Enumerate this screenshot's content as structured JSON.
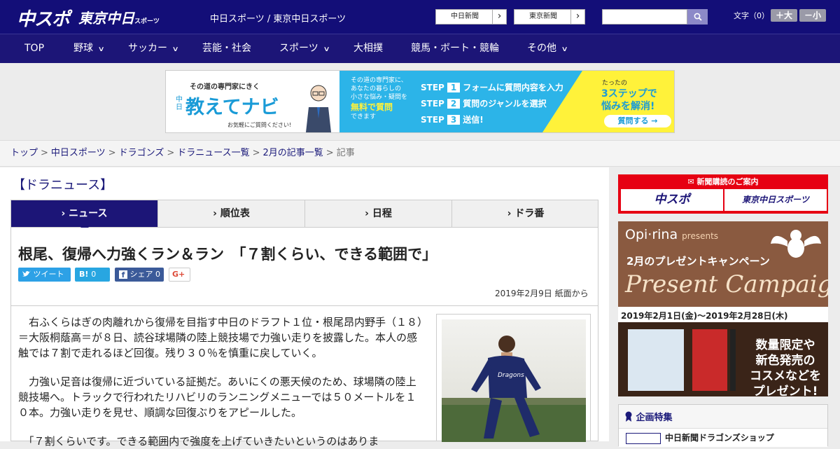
{
  "header": {
    "logo_main": "中スポ",
    "logo_tokyo": "東京中日",
    "logo_tokyo_small": "スポーツ",
    "site_title": "中日スポーツ / 東京中日スポーツ",
    "links": [
      "中日新聞",
      "東京新聞"
    ],
    "link_arrow": "›",
    "font_size_label": "文字（0）",
    "font_plus": "＋大",
    "font_minus": "－小",
    "bg_color": "#130e78"
  },
  "nav": {
    "items": [
      "TOP",
      "野球",
      "サッカー",
      "芸能・社会",
      "スポーツ",
      "大相撲",
      "競馬・ボート・競輪",
      "その他"
    ],
    "chevron": "∨"
  },
  "banner": {
    "tagline": "その道の専門家にきく",
    "brand": "教えてナビ",
    "brand_prefix": "中日",
    "note": "お気軽にご質問ください!",
    "intro": [
      "その道の専門家に、",
      "あなたの暮らしの",
      "小さな悩み・疑問を",
      "無料で質問",
      "できます"
    ],
    "steps": [
      {
        "label": "STEP",
        "num": "1",
        "text": "フォームに質問内容を入力"
      },
      {
        "label": "STEP",
        "num": "2",
        "text": "質問のジャンルを選択"
      },
      {
        "label": "STEP",
        "num": "3",
        "text": "送信!"
      }
    ],
    "cta_top": "たったの",
    "cta_main": "3ステップで",
    "cta_sub": "悩みを解消!",
    "cta_button": "質問する →"
  },
  "breadcrumbs": {
    "items": [
      "トップ",
      "中日スポーツ",
      "ドラゴンズ",
      "ドラニュース一覧",
      "2月の記事一覧"
    ],
    "separator": ">",
    "current": "記事"
  },
  "section_title": "【ドラニュース】",
  "tabs": [
    {
      "label": "› ニュース"
    },
    {
      "label": "› 順位表"
    },
    {
      "label": "› 日程"
    },
    {
      "label": "› ドラ番"
    }
  ],
  "article": {
    "headline": "根尾、復帰へ力強くラン＆ラン　「７割くらい、できる範囲で」",
    "share": {
      "tweet": "ツイート",
      "hatena": "B!",
      "hatena_count": "0",
      "facebook": "シェア",
      "facebook_count": "0",
      "gplus": "G+"
    },
    "date": "2019年2月9日 紙面から",
    "paragraphs": [
      "　右ふくらはぎの肉離れから復帰を目指す中日のドラフト１位・根尾昂内野手（１８）＝大阪桐蔭高＝が８日、読谷球場隣の陸上競技場で力強い走りを披露した。本人の感触では７割で走れるほど回復。残り３０％を慎重に戻していく。",
      "　力強い足音は復帰に近づいている証拠だ。あいにくの悪天候のため、球場隣の陸上競技場へ。トラックで行われたリハビリのランニングメニューでは５０メートルを１０本。力強い走りを見せ、順調な回復ぶりをアピールした。",
      "　「７割くらいです。できる範囲内で強度を上げていきたいというのはありま"
    ],
    "photo_jersey_text": "Dragons"
  },
  "sidebar": {
    "subscribe_label": "新聞購読のご案内",
    "subscribe_boxes": [
      "中スポ",
      "東京中日スポーツ"
    ],
    "ad": {
      "brand": "Opi·rina",
      "brand_suffix": "presents",
      "campaign": "2月のプレゼントキャンペーン",
      "headline": "Present Campaign",
      "dates": "2019年2月1日(金)～2019年2月28日(木)",
      "promo": [
        "数量限定や",
        "新色発売の",
        "コスメなどを",
        "プレゼント!"
      ]
    },
    "feature_title": "企画特集",
    "feature_item": "中日新聞ドラゴンズショップ"
  }
}
